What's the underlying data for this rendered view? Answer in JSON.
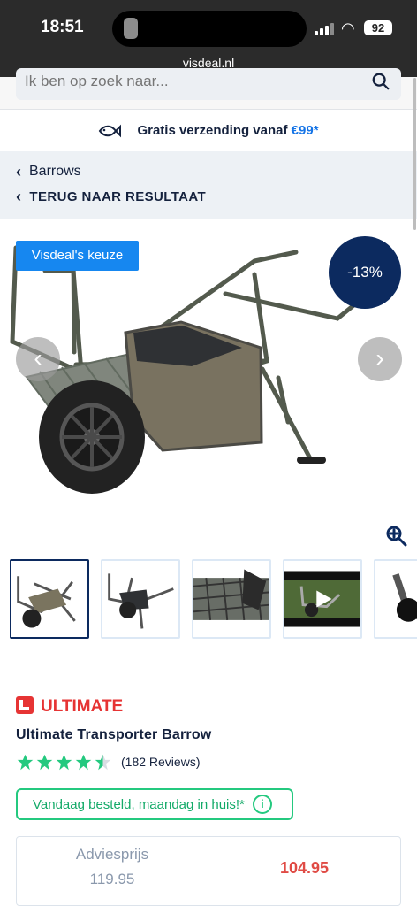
{
  "status": {
    "time": "18:51",
    "battery": "92",
    "url": "visdeal.nl"
  },
  "search": {
    "placeholder": "Ik ben op zoek naar..."
  },
  "shipping": {
    "text": "Gratis verzending vanaf",
    "price": "€99*"
  },
  "breadcrumbs": {
    "category": "Barrows",
    "back": "TERUG NAAR RESULTAAT"
  },
  "product": {
    "badge": "Visdeal's keuze",
    "discount": "-13%",
    "brand": "ULTIMATE",
    "title": "Ultimate Transporter Barrow",
    "rating": 4.5,
    "reviews": "(182 Reviews)",
    "delivery": "Vandaag besteld, maandag in huis!*",
    "advice_label": "Adviesprijs",
    "advice_price": "119.95",
    "price": "104.95"
  },
  "gallery": {
    "image_icon": "wheelbarrow-product-photo",
    "prev": "‹",
    "next": "›",
    "zoom": "zoom-icon",
    "thumbnails": [
      "barrow-main",
      "barrow-side",
      "barrow-detail",
      "barrow-video",
      "barrow-partial"
    ]
  },
  "colors": {
    "blue": "#1687f0",
    "navy": "#0c2a5f",
    "green": "#24c97f",
    "red": "#e04b45"
  }
}
